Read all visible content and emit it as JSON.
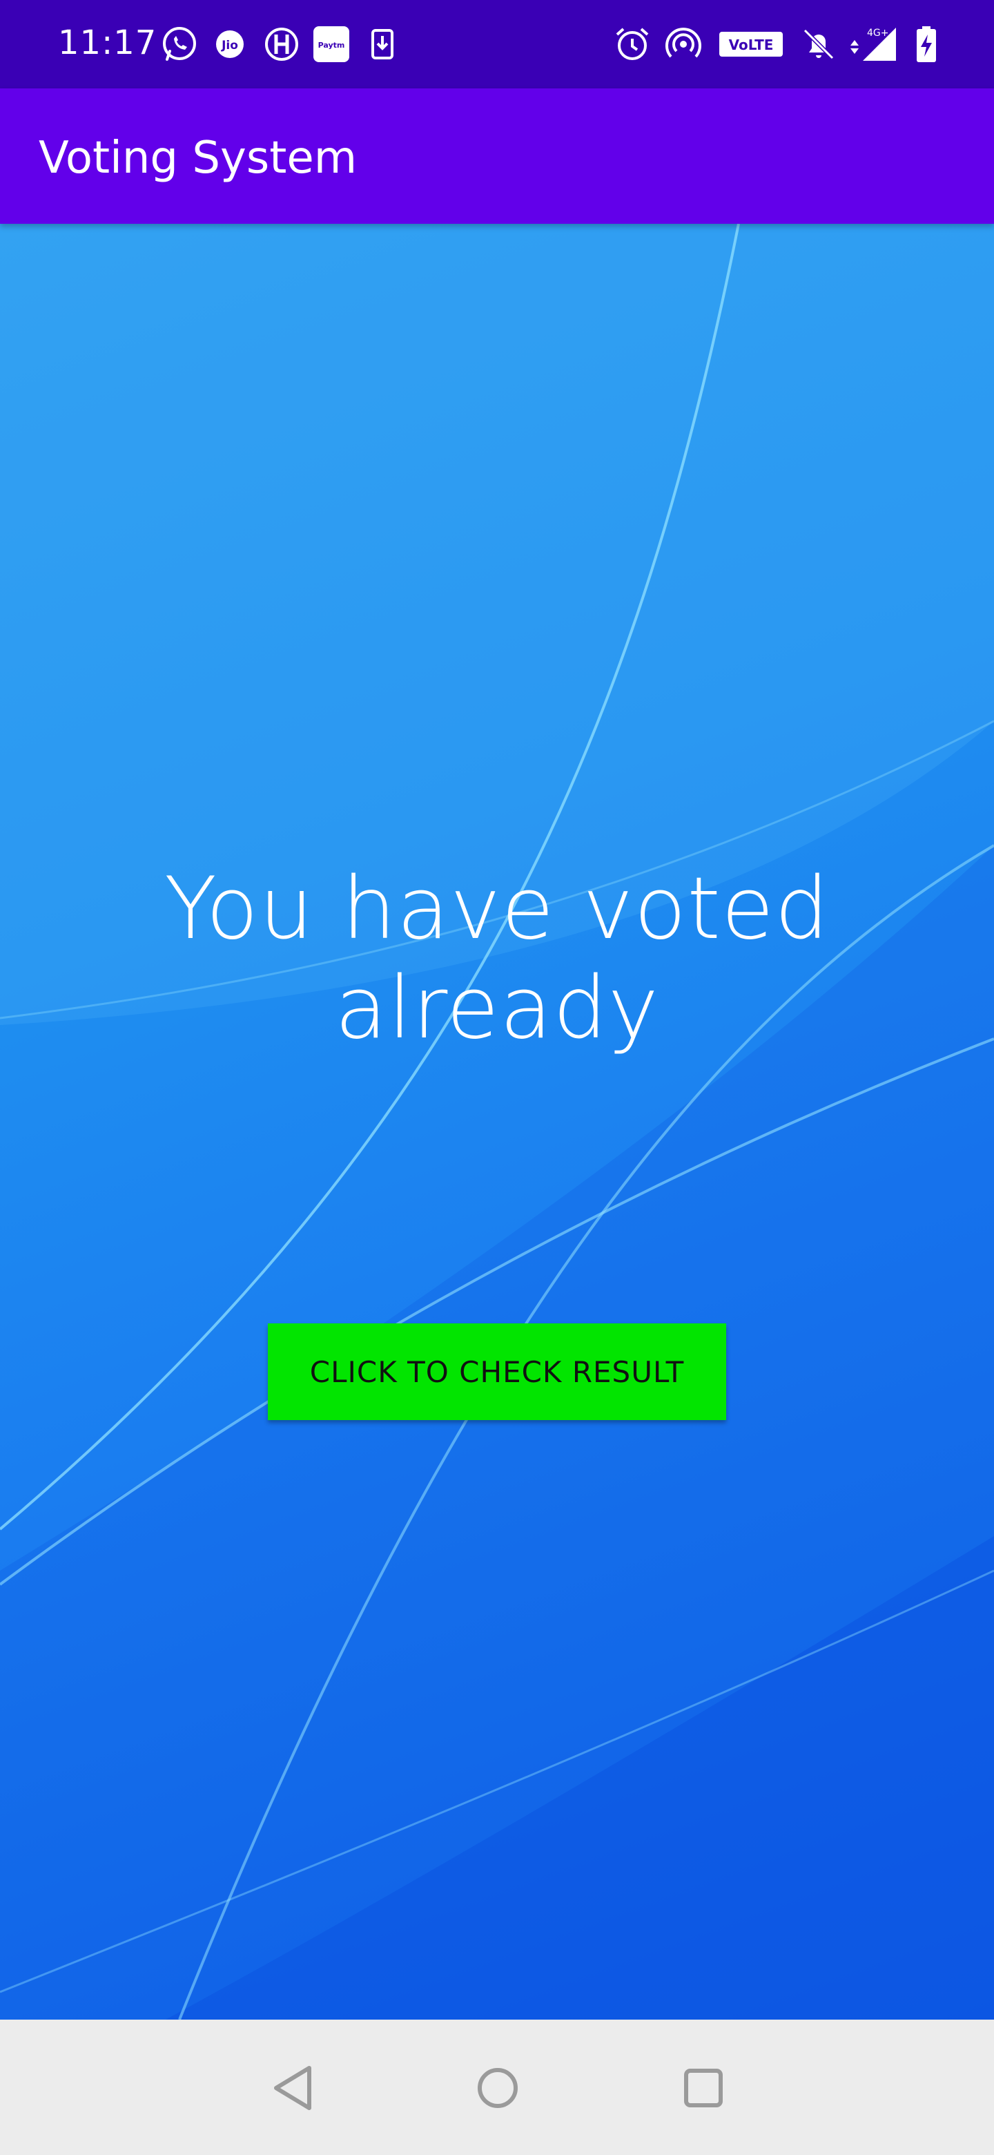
{
  "status_bar": {
    "time": "11:17",
    "left_icons": [
      "whatsapp-icon",
      "jio-icon",
      "hotstar-icon",
      "paytm-icon",
      "download-icon"
    ],
    "right_icons": [
      "alarm-icon",
      "hotspot-icon",
      "volte-icon",
      "mute-icon",
      "signal-4g-icon",
      "battery-charging-icon"
    ],
    "paytm_label": "Paytm",
    "jio_label": "Jio",
    "volte_label": "VoLTE",
    "network_label": "4G+"
  },
  "app_bar": {
    "title": "Voting System",
    "color": "#6200ea"
  },
  "main": {
    "message": "You have voted already",
    "button_label": "CLICK TO CHECK RESULT",
    "button_color": "#02e500"
  },
  "nav_bar": {
    "buttons": [
      "back-icon",
      "home-icon",
      "recents-icon"
    ]
  }
}
